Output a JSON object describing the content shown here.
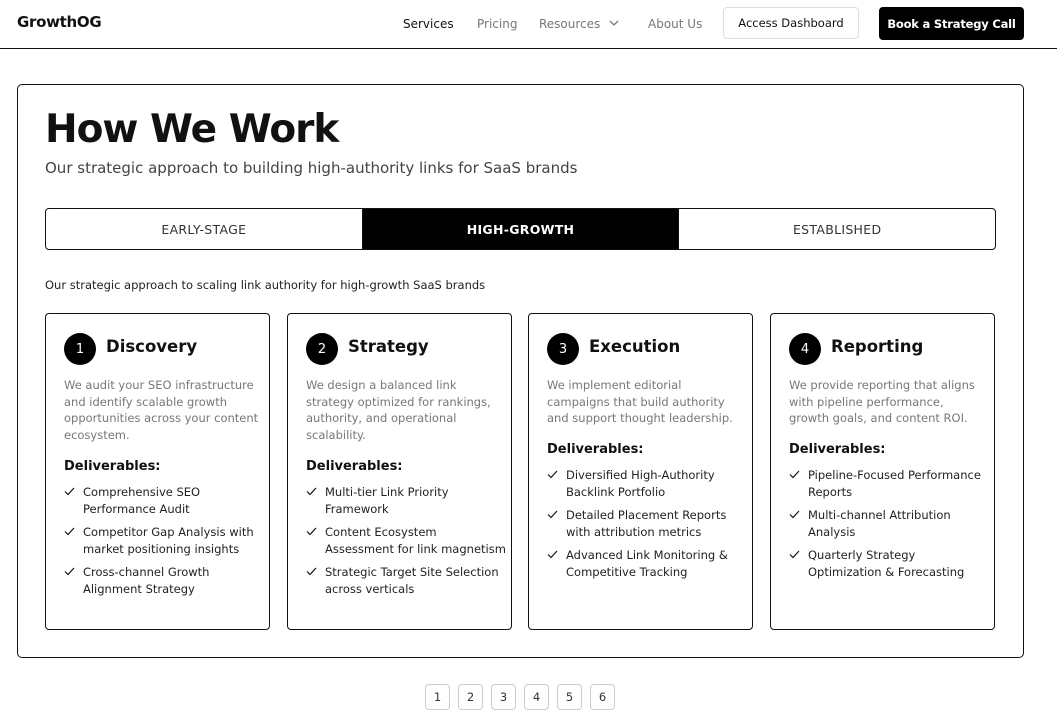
{
  "header": {
    "logo": "GrowthOG",
    "nav": {
      "services": "Services",
      "pricing": "Pricing",
      "resources": "Resources",
      "about": "About Us"
    },
    "access_dashboard": "Access Dashboard",
    "book_call": "Book a Strategy Call"
  },
  "section": {
    "title": "How We Work",
    "subtitle": "Our strategic approach to building high-authority links for SaaS brands",
    "tabs": [
      "EARLY-STAGE",
      "HIGH-GROWTH",
      "ESTABLISHED"
    ],
    "active_tab": "HIGH-GROWTH",
    "tab_description": "Our strategic approach to scaling link authority for high-growth SaaS brands",
    "deliverables_label": "Deliverables:"
  },
  "steps": [
    {
      "number": "1",
      "title": "Discovery",
      "description": "We audit your SEO infrastructure and identify scalable growth opportunities across your content ecosystem.",
      "deliverables": [
        "Comprehensive SEO Performance Audit",
        "Competitor Gap Analysis with market positioning insights",
        "Cross-channel Growth Alignment Strategy"
      ]
    },
    {
      "number": "2",
      "title": "Strategy",
      "description": "We design a balanced link strategy optimized for rankings, authority, and operational scalability.",
      "deliverables": [
        "Multi-tier Link Priority Framework",
        "Content Ecosystem Assessment for link magnetism",
        "Strategic Target Site Selection across verticals"
      ]
    },
    {
      "number": "3",
      "title": "Execution",
      "description": "We implement editorial campaigns that build authority and support thought leadership.",
      "deliverables": [
        "Diversified High-Authority Backlink Portfolio",
        "Detailed Placement Reports with attribution metrics",
        "Advanced Link Monitoring & Competitive Tracking"
      ]
    },
    {
      "number": "4",
      "title": "Reporting",
      "description": "We provide reporting that aligns with pipeline performance, growth goals, and content ROI.",
      "deliverables": [
        "Pipeline-Focused Performance Reports",
        "Multi-channel Attribution Analysis",
        "Quarterly Strategy Optimization & Forecasting"
      ]
    }
  ],
  "pagination": [
    "1",
    "2",
    "3",
    "4",
    "5",
    "6"
  ]
}
